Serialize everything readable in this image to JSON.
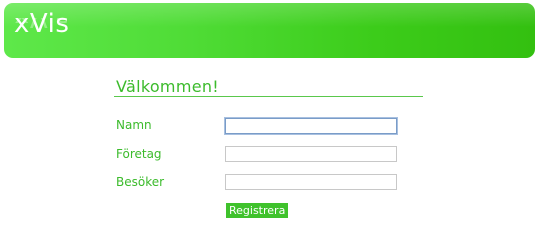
{
  "header": {
    "logo_text": "xVis"
  },
  "form": {
    "heading": "Välkommen!",
    "fields": [
      {
        "label": "Namn",
        "value": ""
      },
      {
        "label": "Företag",
        "value": ""
      },
      {
        "label": "Besöker",
        "value": ""
      }
    ],
    "submit_label": "Registrera"
  },
  "colors": {
    "brand_green": "#3cbb2c",
    "button_green": "#3fc22c",
    "header_gradient_start": "#5ee84a",
    "header_gradient_end": "#33c010"
  }
}
